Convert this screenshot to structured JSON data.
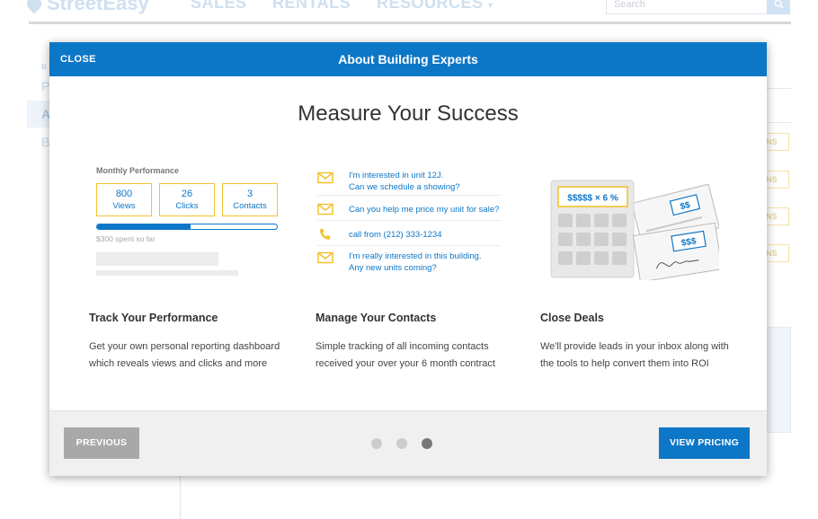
{
  "background": {
    "logo_text": "StreetEasy",
    "nav": [
      "SALES",
      "RENTALS",
      "RESOURCES"
    ],
    "search_placeholder": "Search",
    "search_icon": "search-icon",
    "sidebar_letters": [
      "P",
      "A",
      "B"
    ],
    "pill_text": [
      "NS",
      "NS",
      "NS",
      "NS"
    ]
  },
  "modal": {
    "close_label": "CLOSE",
    "title": "About Building Experts",
    "heading": "Measure Your Success",
    "performance": {
      "title": "Monthly Performance",
      "stats": [
        {
          "value": "800",
          "label": "Views"
        },
        {
          "value": "26",
          "label": "Clicks"
        },
        {
          "value": "3",
          "label": "Contacts"
        }
      ],
      "spend_progress": 0.52,
      "spent_text": "$300 spent so far"
    },
    "contacts": [
      {
        "icon": "mail-icon",
        "line1": "I'm interested in unit 12J.",
        "line2": "Can we schedule a showing?"
      },
      {
        "icon": "mail-icon",
        "line1": "Can you help me price my unit for sale?",
        "line2": ""
      },
      {
        "icon": "phone-icon",
        "line1": "call from (212) 333-1234",
        "line2": ""
      },
      {
        "icon": "mail-icon",
        "line1": "I'm really interested in this building.",
        "line2": "Any new units coming?"
      }
    ],
    "deals_illustration": {
      "display_text": "$$$$$ × 6 %",
      "check1_amount": "$$",
      "check2_amount": "$$$",
      "accent_color": "#f1c232",
      "brand_color": "#0d77c7"
    },
    "features": [
      {
        "title": "Track Your Performance",
        "description": "Get your own personal reporting dashboard which reveals views and clicks and more"
      },
      {
        "title": "Manage Your Contacts",
        "description": "Simple tracking of all incoming contacts received your over your 6 month contract"
      },
      {
        "title": "Close Deals",
        "description": "We'll provide leads in your inbox along with the tools to help convert them into ROI"
      }
    ],
    "footer": {
      "previous_label": "PREVIOUS",
      "pricing_label": "VIEW PRICING",
      "slide_count": 3,
      "active_slide": 3
    }
  }
}
